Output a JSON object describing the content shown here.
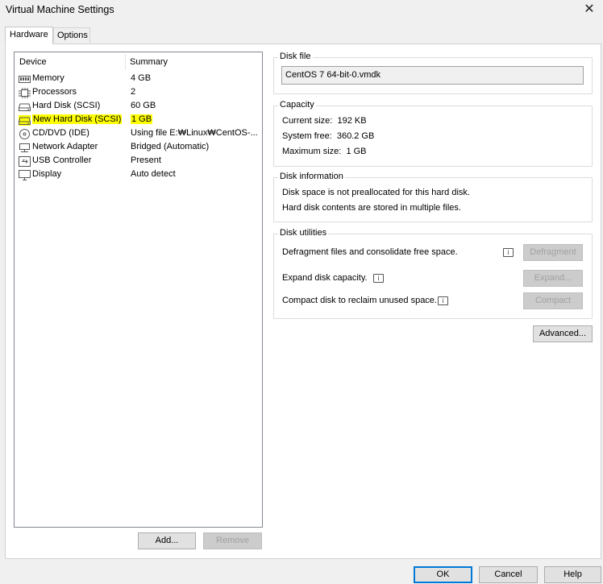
{
  "window": {
    "title": "Virtual Machine Settings",
    "close_icon": "✕"
  },
  "tabs": [
    {
      "label": "Hardware",
      "active": true
    },
    {
      "label": "Options",
      "active": false
    }
  ],
  "device_list": {
    "columns": {
      "device": "Device",
      "summary": "Summary"
    },
    "rows": [
      {
        "device": "Memory",
        "summary": "4 GB",
        "icon": "memory-icon"
      },
      {
        "device": "Processors",
        "summary": "2",
        "icon": "processor-icon"
      },
      {
        "device": "Hard Disk (SCSI)",
        "summary": "60 GB",
        "icon": "hard-disk-icon"
      },
      {
        "device": "New Hard Disk (SCSI)",
        "summary": "1 GB",
        "icon": "hard-disk-icon",
        "highlighted": true
      },
      {
        "device": "CD/DVD (IDE)",
        "summary": "Using file E:₩Linux₩CentOS-...",
        "icon": "cd-dvd-icon"
      },
      {
        "device": "Network Adapter",
        "summary": "Bridged (Automatic)",
        "icon": "network-adapter-icon"
      },
      {
        "device": "USB Controller",
        "summary": "Present",
        "icon": "usb-icon"
      },
      {
        "device": "Display",
        "summary": "Auto detect",
        "icon": "display-icon"
      }
    ],
    "highlight_color": "#ffff00",
    "add_label": "Add...",
    "remove_label": "Remove"
  },
  "disk_file": {
    "group_label": "Disk file",
    "value": "CentOS 7 64-bit-0.vmdk"
  },
  "capacity": {
    "group_label": "Capacity",
    "current_size": "Current size:  192 KB",
    "system_free": "System free:  360.2 GB",
    "maximum_size": "Maximum size:  1 GB"
  },
  "disk_information": {
    "group_label": "Disk information",
    "line1": "Disk space is not preallocated for this hard disk.",
    "line2": "Hard disk contents are stored in multiple files."
  },
  "disk_utilities": {
    "group_label": "Disk utilities",
    "defragment_text": "Defragment files and consolidate free space.",
    "defragment_button": "Defragment",
    "expand_text": "Expand disk capacity.",
    "expand_button": "Expand...",
    "compact_text": "Compact disk to reclaim unused space.",
    "compact_button": "Compact"
  },
  "advanced_button": "Advanced...",
  "footer": {
    "ok": "OK",
    "cancel": "Cancel",
    "help": "Help"
  }
}
